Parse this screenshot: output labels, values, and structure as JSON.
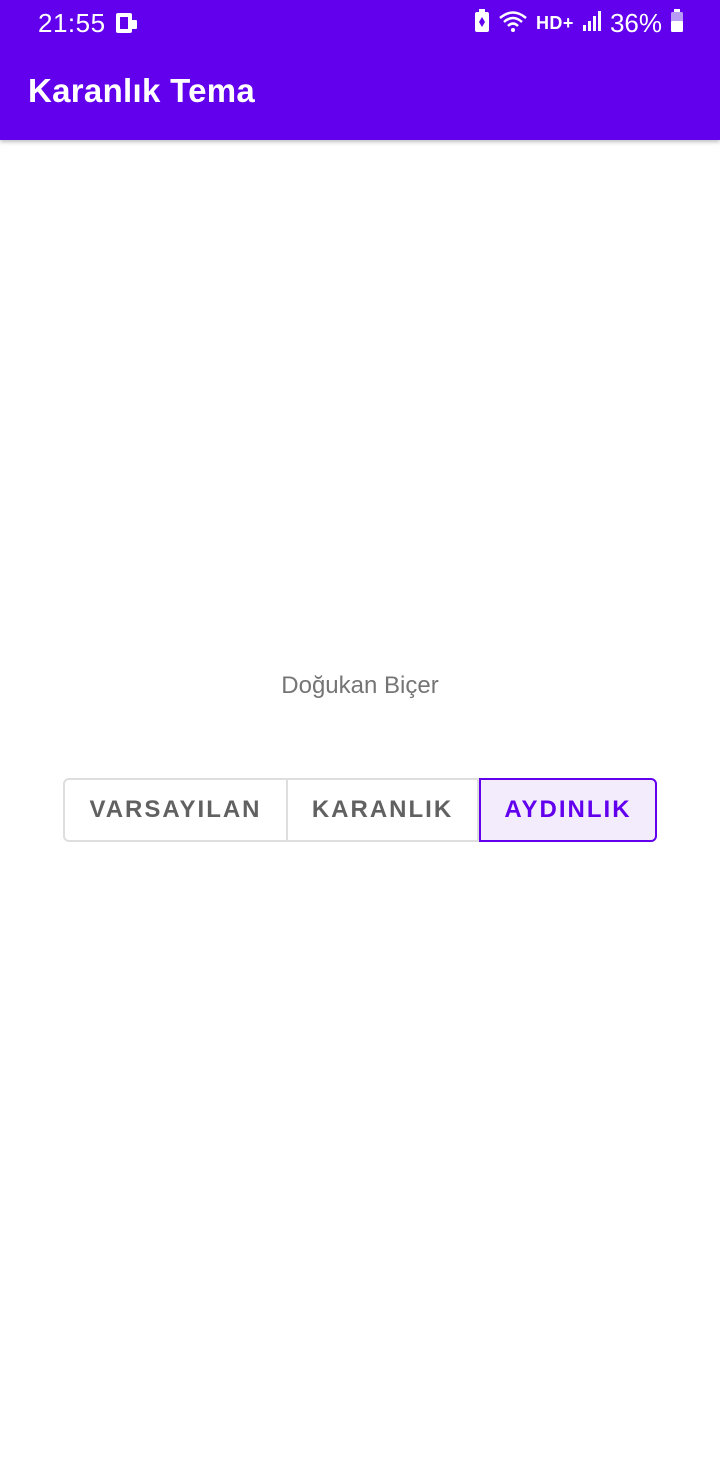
{
  "status_bar": {
    "time": "21:55",
    "network_label": "HD+",
    "battery_percent": "36%",
    "icons": [
      "screen-mirror-icon",
      "battery-saver-icon",
      "wifi-icon",
      "signal-icon",
      "battery-icon"
    ]
  },
  "app_bar": {
    "title": "Karanlık Tema"
  },
  "main": {
    "author": "Doğukan Biçer",
    "theme_toggle": {
      "options": [
        {
          "label": "VARSAYILAN",
          "selected": false
        },
        {
          "label": "KARANLIK",
          "selected": false
        },
        {
          "label": "AYDINLIK",
          "selected": true
        }
      ]
    }
  },
  "colors": {
    "primary": "#6200EE",
    "selected_bg": "#F3ECFD",
    "text_secondary": "#757575",
    "button_text": "#616161",
    "outline": "#DEDEDE"
  }
}
